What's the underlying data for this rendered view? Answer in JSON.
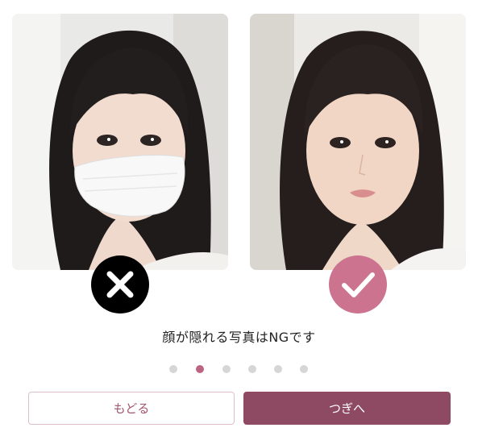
{
  "examples": [
    {
      "id": "ng",
      "photo_subject": "woman-wearing-face-mask",
      "badge_icon": "cross-icon",
      "badge_color": "#000000"
    },
    {
      "id": "ok",
      "photo_subject": "woman-face-uncovered",
      "badge_icon": "checkmark-icon",
      "badge_color": "#cc7390"
    }
  ],
  "caption": "顔が隠れる写真はNGです",
  "pagination": {
    "total": 6,
    "current": 2,
    "active_color": "#bc6482",
    "inactive_color": "#d6d6d6"
  },
  "buttons": {
    "back_label": "もどる",
    "next_label": "つぎへ"
  },
  "colors": {
    "primary": "#8e4a63",
    "accent": "#cc7390"
  }
}
